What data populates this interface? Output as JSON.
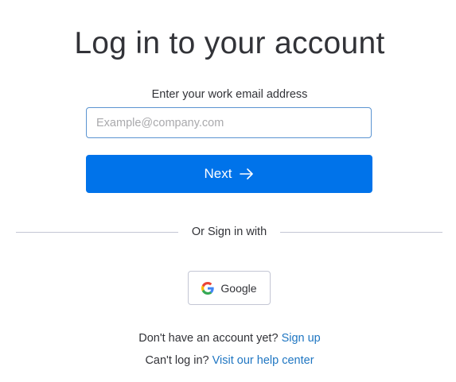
{
  "heading": "Log in to your account",
  "email": {
    "label": "Enter your work email address",
    "placeholder": "Example@company.com",
    "value": ""
  },
  "next_button": {
    "label": "Next",
    "icon": "arrow-right-icon"
  },
  "divider": {
    "text": "Or Sign in with"
  },
  "google_button": {
    "label": "Google",
    "icon": "google-logo-icon"
  },
  "footer": {
    "signup_prompt": "Don't have an account yet?",
    "signup_link": "Sign up",
    "help_prompt": "Can't log in?",
    "help_link": "Visit our help center"
  },
  "colors": {
    "primary": "#0073ea",
    "link": "#1f76c2",
    "text": "#323338",
    "input_border": "#5b94d1",
    "divider": "#c3c6d4"
  }
}
